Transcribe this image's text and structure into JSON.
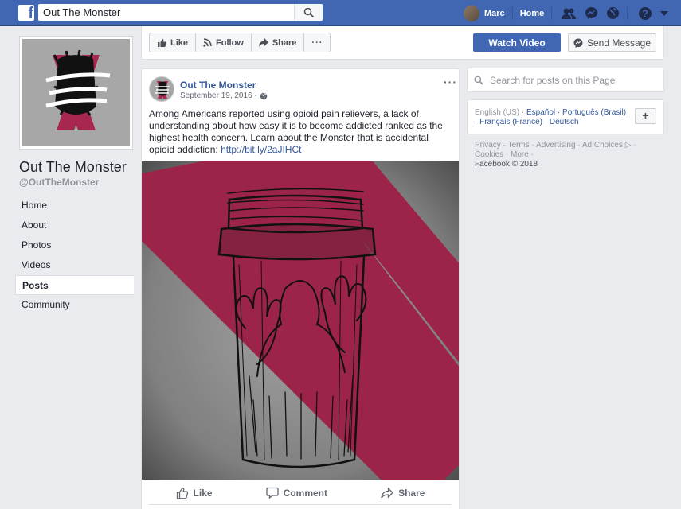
{
  "topbar": {
    "search_value": "Out The Monster",
    "user_name": "Marc",
    "home_label": "Home"
  },
  "page": {
    "name": "Out The Monster",
    "handle": "@OutTheMonster"
  },
  "left_nav": {
    "items": [
      {
        "label": "Home"
      },
      {
        "label": "About"
      },
      {
        "label": "Photos"
      },
      {
        "label": "Videos"
      },
      {
        "label": "Posts",
        "active": true
      },
      {
        "label": "Community"
      }
    ]
  },
  "action_bar": {
    "like_label": "Like",
    "follow_label": "Follow",
    "share_label": "Share",
    "more_label": "···",
    "watch_video_label": "Watch Video",
    "send_message_label": "Send Message"
  },
  "post": {
    "author": "Out The Monster",
    "date": "September 19, 2016 ·",
    "text": "Among Americans reported using opioid pain relievers, a lack of understanding about how easy it is to become addicted ranked as the highest health concern. Learn about the Monster that is accidental opioid addiction: ",
    "link": "http://bit.ly/2aJIHCt",
    "menu_label": "···",
    "like_label": "Like",
    "comment_label": "Comment",
    "share_label": "Share"
  },
  "sidebar": {
    "search_placeholder": "Search for posts on this Page",
    "languages_line1_prefix": "English (US) · ",
    "languages_line1_links": "Español · Português (Brasil)",
    "languages_line2": "· Français (France) · Deutsch",
    "lang_plus": "+",
    "footer_links_line1": "Privacy · Terms · Advertising · Ad Choices ▷ ·",
    "footer_links_line2": "Cookies · More ·",
    "copyright": "Facebook © 2018"
  },
  "colors": {
    "brand_blue": "#4267b2",
    "link_blue": "#365899",
    "poster_red": "#a8274e",
    "background": "#e9ebee"
  }
}
